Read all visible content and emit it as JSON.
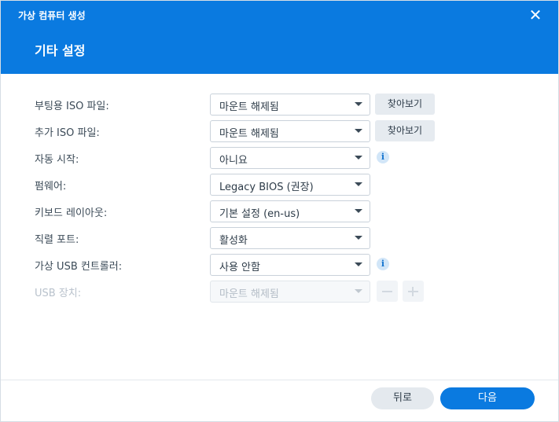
{
  "window": {
    "title": "가상 컴퓨터 생성",
    "close_icon": "close-icon"
  },
  "step": {
    "title": "기타 설정"
  },
  "fields": [
    {
      "label": "부팅용 ISO 파일:",
      "value": "마운트 해제됨",
      "button": "찾아보기"
    },
    {
      "label": "추가 ISO 파일:",
      "value": "마운트 해제됨",
      "button": "찾아보기"
    },
    {
      "label": "자동 시작:",
      "value": "아니요",
      "info": "i"
    },
    {
      "label": "펌웨어:",
      "value": "Legacy BIOS (권장)"
    },
    {
      "label": "키보드 레이아웃:",
      "value": "기본 설정 (en-us)"
    },
    {
      "label": "직렬 포트:",
      "value": "활성화"
    },
    {
      "label": "가상 USB 컨트롤러:",
      "value": "사용 안함",
      "info": "i"
    },
    {
      "label": "USB 장치:",
      "value": "마운트 해제됨",
      "disabled": true
    }
  ],
  "footer": {
    "back_label": "뒤로",
    "next_label": "다음"
  },
  "colors": {
    "accent": "#0a7ae0",
    "button_gray": "#e4e9ee",
    "disabled_text": "#b9c2cc"
  }
}
